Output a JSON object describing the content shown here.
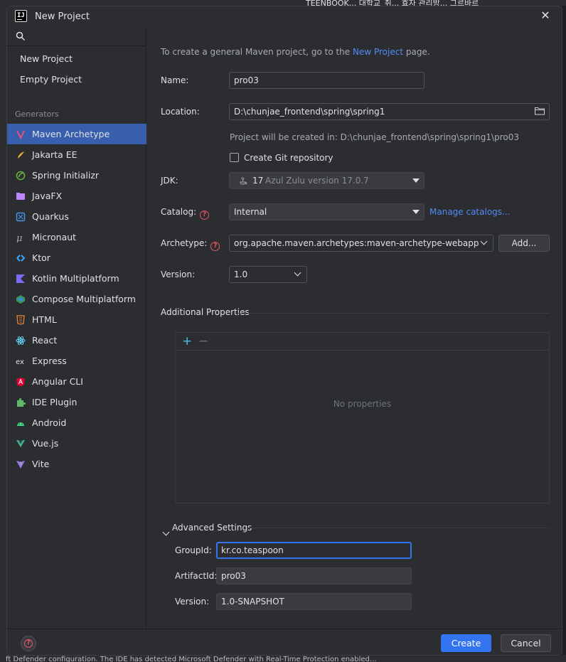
{
  "window": {
    "title": "New Project",
    "close_label": "✕"
  },
  "background": {
    "top_text": "TEENBOOK...   대학교_취...   효자 관리방...   그르바르",
    "bottom_text": "ft Defender configuration. The IDE has detected Microsoft Defender with Real-Time Protection enabled..."
  },
  "sidebar": {
    "search_placeholder": "",
    "top_items": [
      {
        "label": "New Project"
      },
      {
        "label": "Empty Project"
      }
    ],
    "generators_label": "Generators",
    "generators": [
      {
        "label": "Maven Archetype",
        "icon": "maven-icon",
        "selected": true
      },
      {
        "label": "Jakarta EE",
        "icon": "jakarta-ee-icon"
      },
      {
        "label": "Spring Initializr",
        "icon": "spring-icon"
      },
      {
        "label": "JavaFX",
        "icon": "javafx-icon"
      },
      {
        "label": "Quarkus",
        "icon": "quarkus-icon"
      },
      {
        "label": "Micronaut",
        "icon": "micronaut-icon"
      },
      {
        "label": "Ktor",
        "icon": "ktor-icon"
      },
      {
        "label": "Kotlin Multiplatform",
        "icon": "kotlin-icon"
      },
      {
        "label": "Compose Multiplatform",
        "icon": "compose-icon"
      },
      {
        "label": "HTML",
        "icon": "html-icon"
      },
      {
        "label": "React",
        "icon": "react-icon"
      },
      {
        "label": "Express",
        "icon": "express-icon"
      },
      {
        "label": "Angular CLI",
        "icon": "angular-icon"
      },
      {
        "label": "IDE Plugin",
        "icon": "plugin-icon"
      },
      {
        "label": "Android",
        "icon": "android-icon"
      },
      {
        "label": "Vue.js",
        "icon": "vue-icon"
      },
      {
        "label": "Vite",
        "icon": "vite-icon"
      }
    ]
  },
  "main": {
    "info_prefix": "To create a general Maven project, go to the ",
    "info_link": "New Project",
    "info_suffix": " page.",
    "name": {
      "label": "Name:",
      "value": "pro03"
    },
    "location": {
      "label": "Location:",
      "value": "D:\\chunjae_frontend\\spring\\spring1",
      "hint": "Project will be created in: D:\\chunjae_frontend\\spring\\spring1\\pro03"
    },
    "git": {
      "label": "Create Git repository",
      "checked": false
    },
    "jdk": {
      "label": "JDK:",
      "version": "17",
      "name": "Azul Zulu version 17.0.7"
    },
    "catalog": {
      "label": "Catalog:",
      "value": "Internal",
      "manage_link": "Manage catalogs..."
    },
    "archetype": {
      "label": "Archetype:",
      "value": "org.apache.maven.archetypes:maven-archetype-webapp",
      "add_label": "Add..."
    },
    "version": {
      "label": "Version:",
      "value": "1.0"
    },
    "additional": {
      "title": "Additional Properties",
      "add": "+",
      "remove": "−",
      "empty": "No properties"
    },
    "advanced": {
      "title": "Advanced Settings",
      "group_label": "GroupId:",
      "group_value": "kr.co.teaspoon",
      "artifact_label": "ArtifactId:",
      "artifact_value": "pro03",
      "version_label": "Version:",
      "version_value": "1.0-SNAPSHOT"
    }
  },
  "footer": {
    "help": "?",
    "create_label": "Create",
    "cancel_label": "Cancel"
  },
  "colors": {
    "accent": "#3574f0",
    "selected_bg": "#375fad",
    "link": "#548af7",
    "error": "#e55765"
  }
}
